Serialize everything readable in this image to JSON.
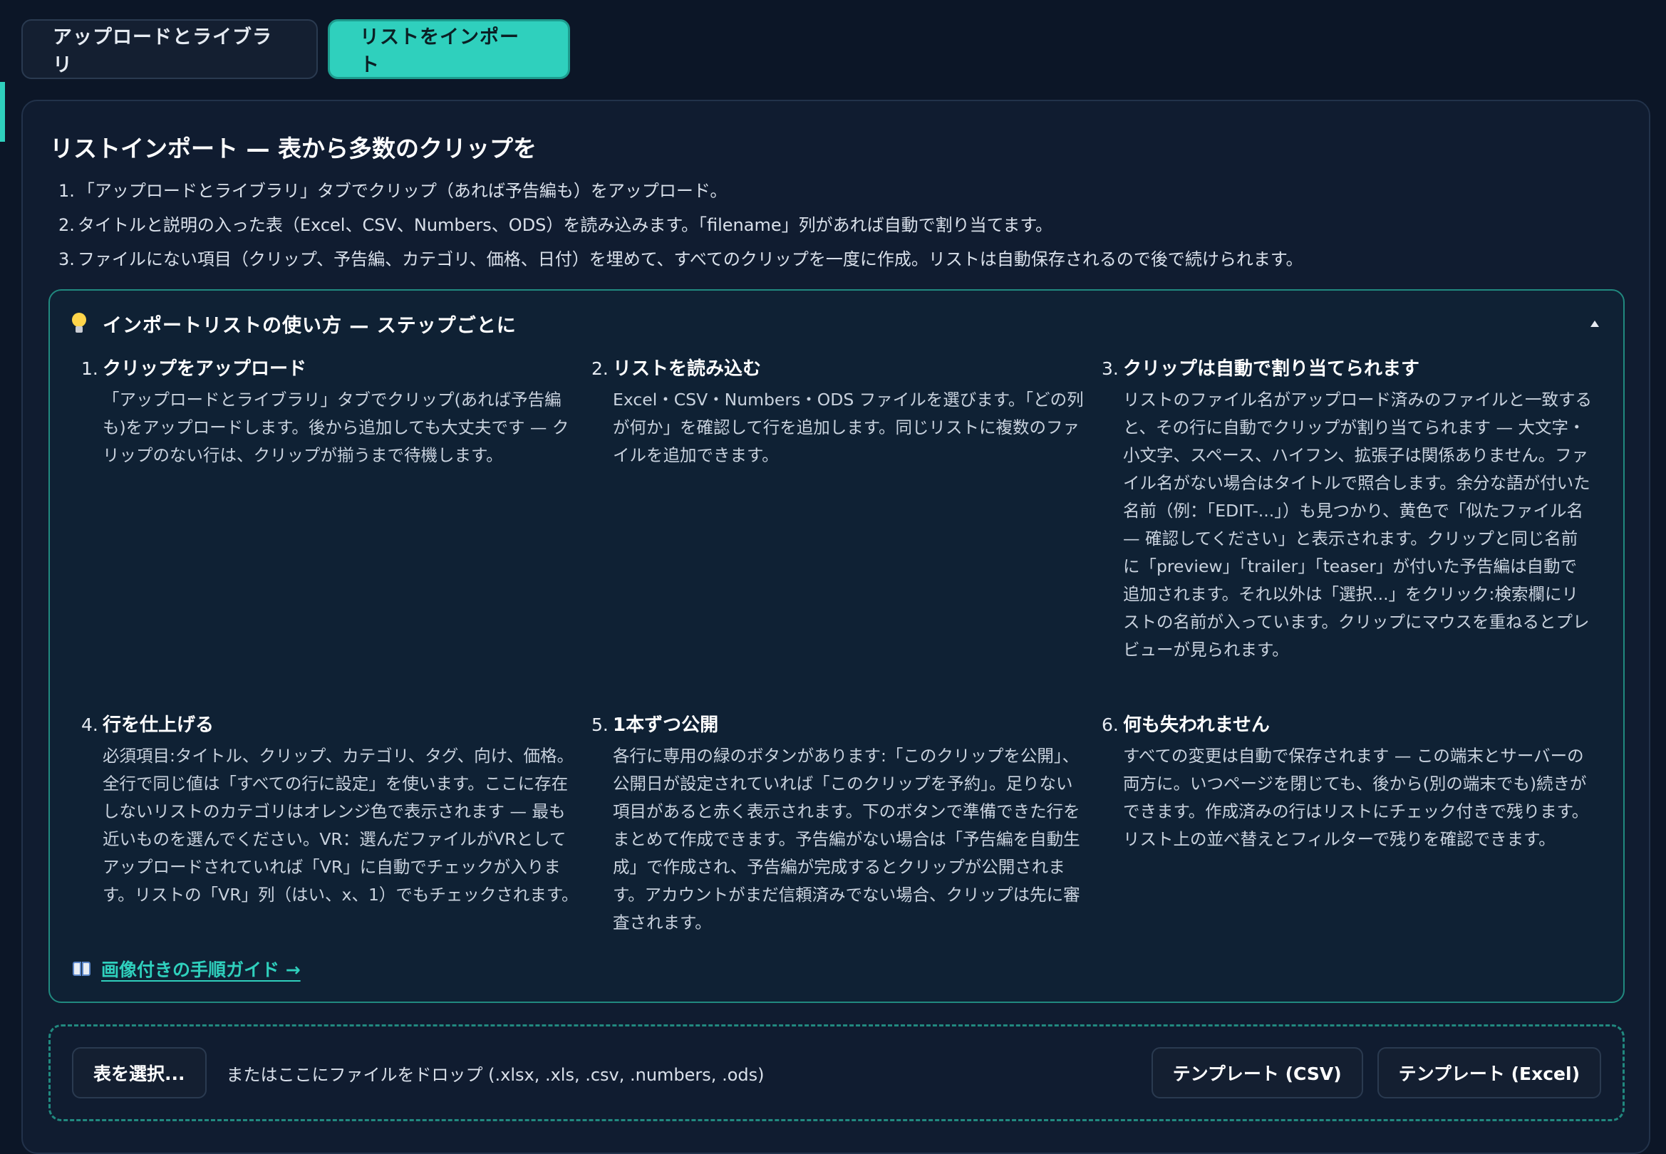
{
  "tabs": [
    {
      "label": "アップロードとライブラリ",
      "active": false
    },
    {
      "label": "リストをインポート",
      "active": true
    }
  ],
  "panel": {
    "title": "リストインポート — 表から多数のクリップを",
    "intro": [
      {
        "num": "1.",
        "text": "「アップロードとライブラリ」タブでクリップ（あれば予告編も）をアップロード。"
      },
      {
        "num": "2.",
        "text": "タイトルと説明の入った表（Excel、CSV、Numbers、ODS）を読み込みます。「filename」列があれば自動で割り当てます。"
      },
      {
        "num": "3.",
        "text": "ファイルにない項目（クリップ、予告編、カテゴリ、価格、日付）を埋めて、すべてのクリップを一度に作成。リストは自動保存されるので後で続けられます。"
      }
    ]
  },
  "guide": {
    "title": "インポートリストの使い方 — ステップごとに",
    "icon": "lightbulb-icon",
    "collapse_icon": "caret-up-icon",
    "steps": [
      {
        "num": "1.",
        "title": "クリップをアップロード",
        "body": "「アップロードとライブラリ」タブでクリップ(あれば予告編も)をアップロードします。後から追加しても大丈夫です — クリップのない行は、クリップが揃うまで待機します。"
      },
      {
        "num": "2.",
        "title": "リストを読み込む",
        "body": "Excel・CSV・Numbers・ODS ファイルを選びます。「どの列が何か」を確認して行を追加します。同じリストに複数のファイルを追加できます。"
      },
      {
        "num": "3.",
        "title": "クリップは自動で割り当てられます",
        "body": "リストのファイル名がアップロード済みのファイルと一致すると、その行に自動でクリップが割り当てられます — 大文字・小文字、スペース、ハイフン、拡張子は関係ありません。ファイル名がない場合はタイトルで照合します。余分な語が付いた名前（例：「EDIT-...」）も見つかり、黄色で「似たファイル名 — 確認してください」と表示されます。クリップと同じ名前に「preview」「trailer」「teaser」が付いた予告編は自動で追加されます。それ以外は「選択...」をクリック:検索欄にリストの名前が入っています。クリップにマウスを重ねるとプレビューが見られます。"
      },
      {
        "num": "4.",
        "title": "行を仕上げる",
        "body": "必須項目:タイトル、クリップ、カテゴリ、タグ、向け、価格。全行で同じ値は「すべての行に設定」を使います。ここに存在しないリストのカテゴリはオレンジ色で表示されます — 最も近いものを選んでください。VR：選んだファイルがVRとしてアップロードされていれば「VR」に自動でチェックが入ります。リストの「VR」列（はい、x、1）でもチェックされます。"
      },
      {
        "num": "5.",
        "title": "1本ずつ公開",
        "body": "各行に専用の緑のボタンがあります:「このクリップを公開」、公開日が設定されていれば「このクリップを予約」。足りない項目があると赤く表示されます。下のボタンで準備できた行をまとめて作成できます。予告編がない場合は「予告編を自動生成」で作成され、予告編が完成するとクリップが公開されます。アカウントがまだ信頼済みでない場合、クリップは先に審査されます。"
      },
      {
        "num": "6.",
        "title": "何も失われません",
        "body": "すべての変更は自動で保存されます — この端末とサーバーの両方に。いつページを閉じても、後から(別の端末でも)続きができます。作成済みの行はリストにチェック付きで残ります。リスト上の並べ替えとフィルターで残りを確認できます。"
      }
    ],
    "link_label": "画像付きの手順ガイド →",
    "link_icon": "book-icon"
  },
  "dropzone": {
    "select_label": "表を選択...",
    "hint": "またはここにファイルをドロップ (.xlsx, .xls, .csv, .numbers, .ods)",
    "template_csv_label": "テンプレート (CSV)",
    "template_excel_label": "テンプレート (Excel)"
  },
  "colors": {
    "accent": "#2fd0bd",
    "background": "#0c1627",
    "panel": "#101c30"
  }
}
